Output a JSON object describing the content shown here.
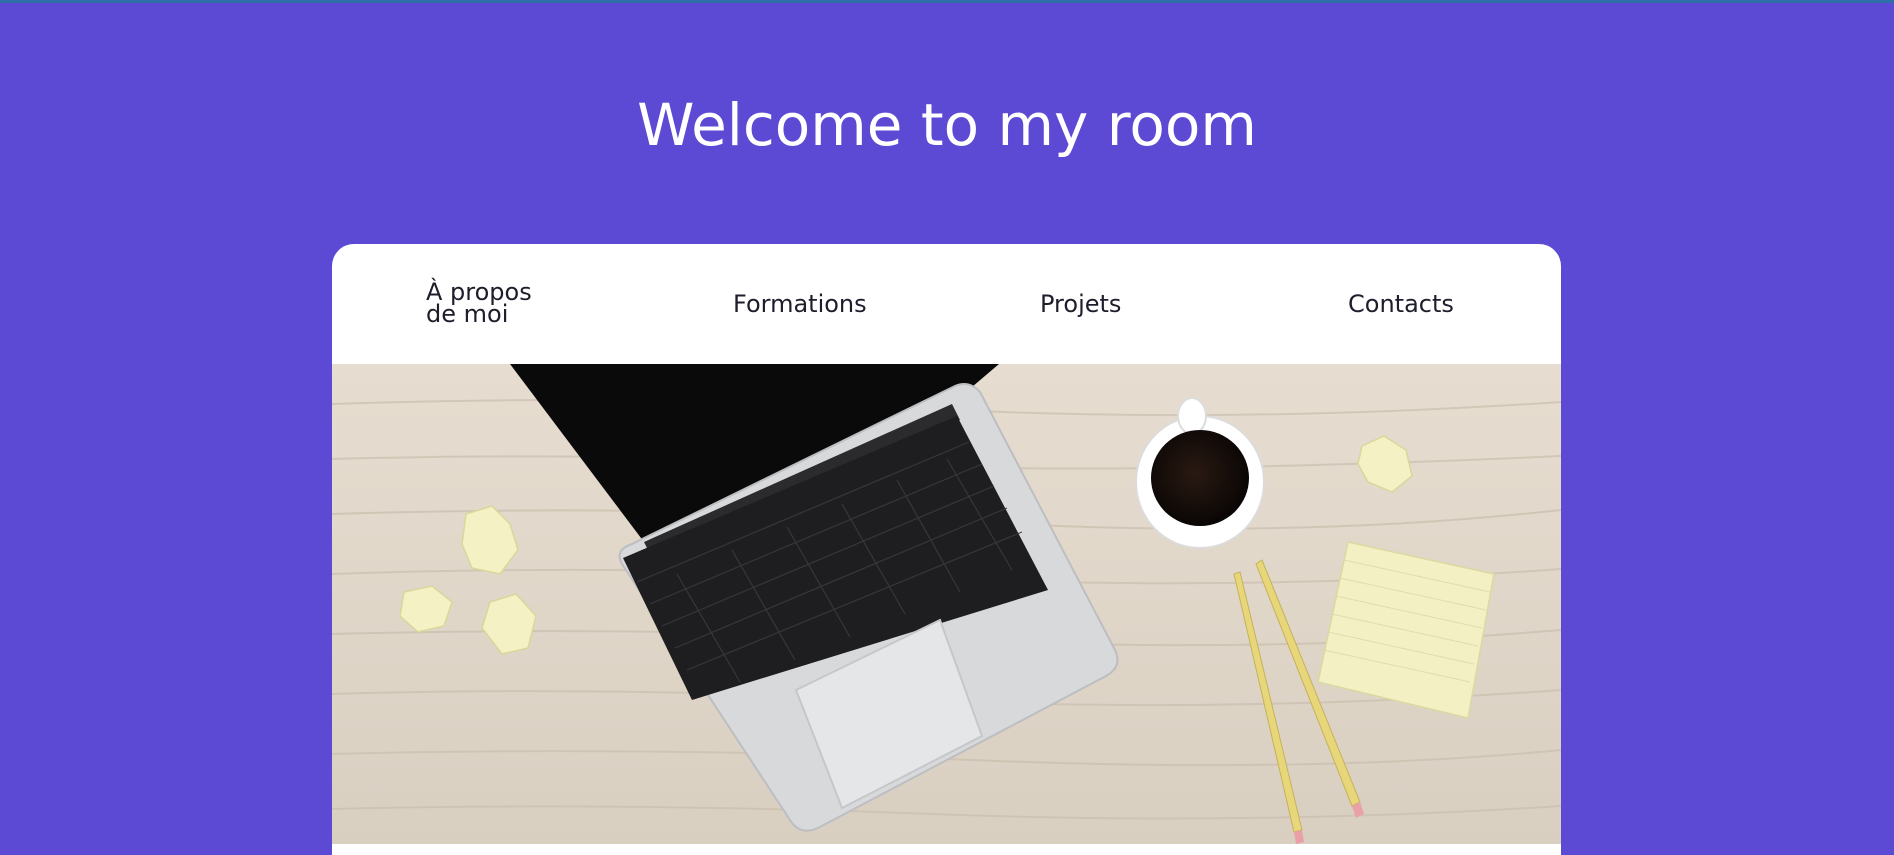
{
  "header": {
    "title": "Welcome to my room"
  },
  "nav": {
    "items": [
      {
        "label": "À propos de moi"
      },
      {
        "label": "Formations"
      },
      {
        "label": "Projets"
      },
      {
        "label": "Contacts"
      }
    ]
  },
  "colors": {
    "background": "#5c49d4",
    "card": "#ffffff",
    "text_light": "#ffffff",
    "text_dark": "#1d1d2b"
  }
}
